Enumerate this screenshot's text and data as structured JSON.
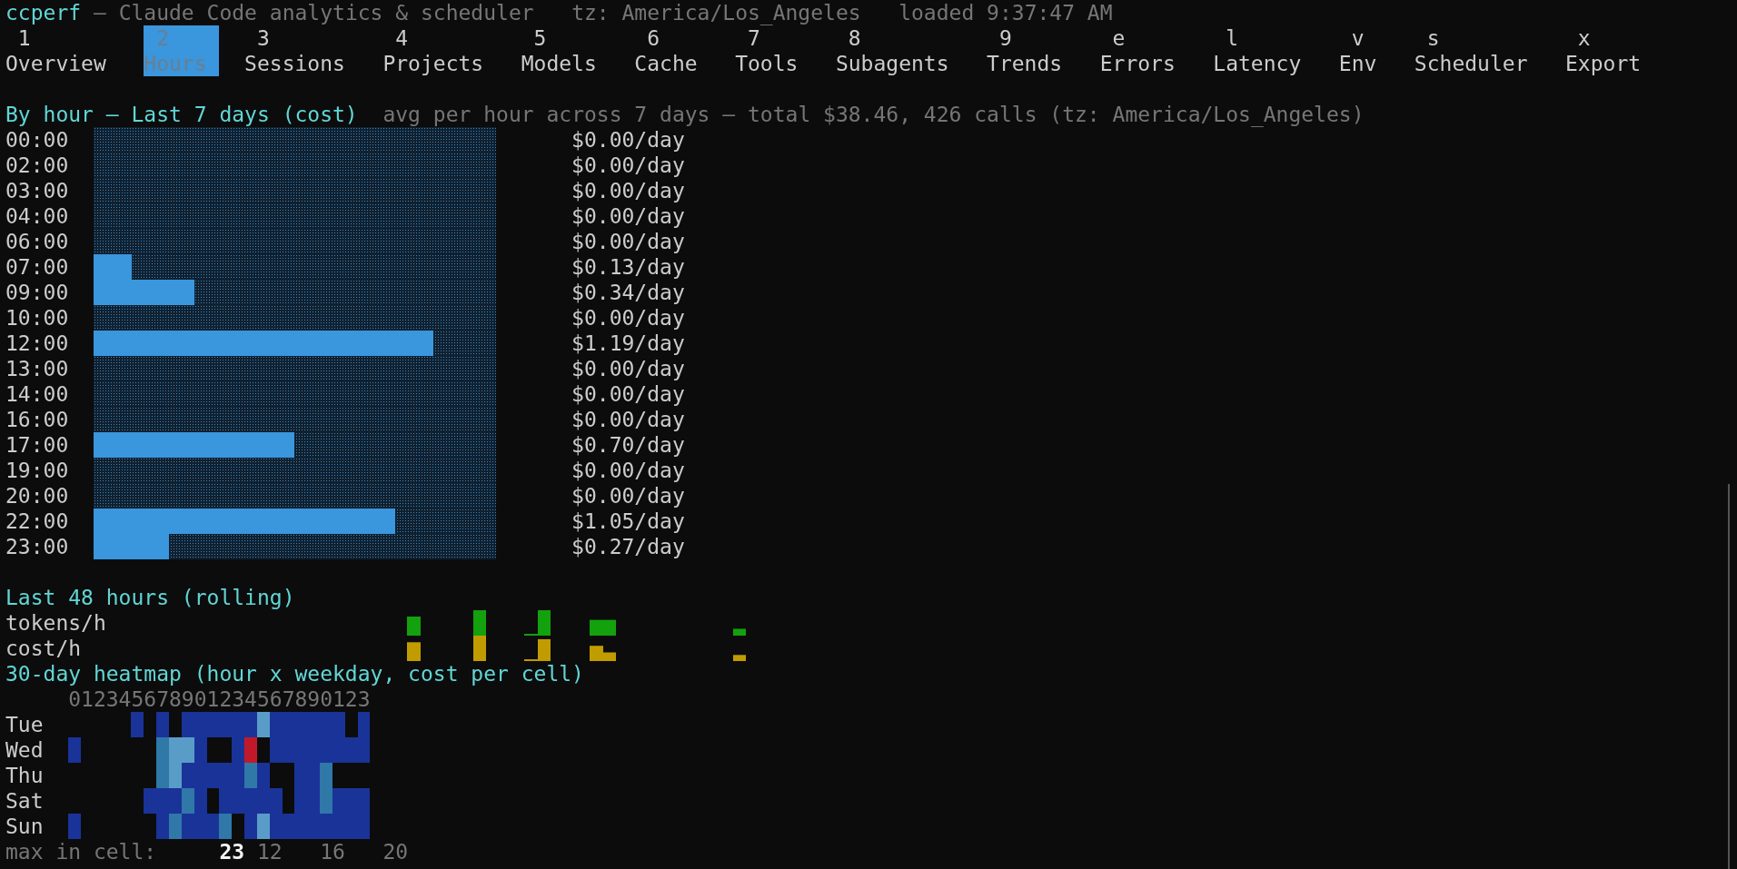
{
  "header": {
    "app": "ccperf",
    "subtitle": "— Claude Code analytics & scheduler",
    "timezone": "tz: America/Los_Angeles",
    "loaded": "loaded 9:37:47 AM"
  },
  "tabs": [
    {
      "key": "1",
      "label": "Overview",
      "selected": false
    },
    {
      "key": "2",
      "label": "Hours",
      "selected": true
    },
    {
      "key": "3",
      "label": "Sessions",
      "selected": false
    },
    {
      "key": "4",
      "label": "Projects",
      "selected": false
    },
    {
      "key": "5",
      "label": "Models",
      "selected": false
    },
    {
      "key": "6",
      "label": "Cache",
      "selected": false
    },
    {
      "key": "7",
      "label": "Tools",
      "selected": false
    },
    {
      "key": "8",
      "label": "Subagents",
      "selected": false
    },
    {
      "key": "9",
      "label": "Trends",
      "selected": false
    },
    {
      "key": "e",
      "label": "Errors",
      "selected": false
    },
    {
      "key": "l",
      "label": "Latency",
      "selected": false
    },
    {
      "key": "v",
      "label": "Env",
      "selected": false
    },
    {
      "key": "s",
      "label": "Scheduler",
      "selected": false
    },
    {
      "key": "x",
      "label": "Export",
      "selected": false
    }
  ],
  "by_hour": {
    "title": "By hour — Last 7 days (cost)",
    "summary": "avg per hour across 7 days — total $38.46, 426 calls (tz: America/Los_Angeles)",
    "rows": [
      {
        "hour": "00:00",
        "value": "$0.00/day"
      },
      {
        "hour": "02:00",
        "value": "$0.00/day"
      },
      {
        "hour": "03:00",
        "value": "$0.00/day"
      },
      {
        "hour": "04:00",
        "value": "$0.00/day"
      },
      {
        "hour": "06:00",
        "value": "$0.00/day"
      },
      {
        "hour": "07:00",
        "level": 0.094,
        "value": "$0.13/day"
      },
      {
        "hour": "09:00",
        "level": 0.25,
        "value": "$0.34/day"
      },
      {
        "hour": "10:00",
        "value": "$0.00/day"
      },
      {
        "hour": "12:00",
        "level": 0.844,
        "value": "$1.19/day"
      },
      {
        "hour": "13:00",
        "value": "$0.00/day"
      },
      {
        "hour": "14:00",
        "value": "$0.00/day"
      },
      {
        "hour": "16:00",
        "value": "$0.00/day"
      },
      {
        "hour": "17:00",
        "level": 0.5,
        "value": "$0.70/day"
      },
      {
        "hour": "19:00",
        "value": "$0.00/day"
      },
      {
        "hour": "20:00",
        "value": "$0.00/day"
      },
      {
        "hour": "22:00",
        "level": 0.75,
        "value": "$1.05/day"
      },
      {
        "hour": "23:00",
        "level": 0.188,
        "value": "$0.27/day"
      }
    ]
  },
  "rolling": {
    "title": "Last 48 hours (rolling)",
    "series": [
      {
        "label": "tokens/h",
        "kind": "tokens"
      },
      {
        "label": "cost/h",
        "kind": "cost"
      }
    ]
  },
  "heatmap": {
    "title": "30-day heatmap (hour x weekday, cost per cell)",
    "hours_axis": "012345678901234567890123",
    "rows": [
      {
        "day": "Tue",
        "cells": [
          null,
          null,
          null,
          null,
          null,
          {
            "color": "#1a3399"
          },
          null,
          {
            "color": "#1a3399"
          },
          null,
          {
            "color": "#1a3399"
          },
          {
            "color": "#1a3399"
          },
          {
            "color": "#1a3399"
          },
          {
            "color": "#1a3399"
          },
          {
            "color": "#1a3399"
          },
          {
            "color": "#1a3399"
          },
          {
            "color": "#5a9cc8"
          },
          {
            "color": "#1a3399"
          },
          {
            "color": "#1a3399"
          },
          {
            "color": "#1a3399"
          },
          {
            "color": "#1a3399"
          },
          {
            "color": "#1a3399"
          },
          {
            "color": "#1a3399"
          },
          null,
          {
            "color": "#1a3399"
          }
        ]
      },
      {
        "day": "Wed",
        "cells": [
          {
            "color": "#1a3399"
          },
          null,
          null,
          null,
          null,
          null,
          null,
          {
            "color": "#2f78a8"
          },
          {
            "color": "#5a9cc8"
          },
          {
            "color": "#5a9cc8"
          },
          {
            "color": "#1a3399"
          },
          null,
          null,
          {
            "color": "#1a3399"
          },
          {
            "color": "#c01a2a"
          },
          null,
          {
            "color": "#1a3399"
          },
          {
            "color": "#1a3399"
          },
          {
            "color": "#1a3399"
          },
          {
            "color": "#1a3399"
          },
          {
            "color": "#1a3399"
          },
          {
            "color": "#1a3399"
          },
          {
            "color": "#1a3399"
          },
          {
            "color": "#1a3399"
          }
        ]
      },
      {
        "day": "Thu",
        "cells": [
          null,
          null,
          null,
          null,
          null,
          null,
          null,
          {
            "color": "#2f78a8"
          },
          {
            "color": "#5a9cc8"
          },
          {
            "color": "#1a3399"
          },
          {
            "color": "#1a3399"
          },
          {
            "color": "#1a3399"
          },
          {
            "color": "#1a3399"
          },
          {
            "color": "#1a3399"
          },
          {
            "color": "#2f78a8"
          },
          {
            "color": "#1a3399"
          },
          null,
          null,
          {
            "color": "#1a3399"
          },
          {
            "color": "#1a3399"
          },
          {
            "color": "#2f78a8"
          },
          null,
          null,
          null
        ]
      },
      {
        "day": "Sat",
        "cells": [
          null,
          null,
          null,
          null,
          null,
          null,
          {
            "color": "#1a3399"
          },
          {
            "color": "#1a3399"
          },
          {
            "color": "#1a3399"
          },
          {
            "color": "#2f78a8"
          },
          {
            "color": "#1a3399"
          },
          null,
          {
            "color": "#1a3399"
          },
          {
            "color": "#1a3399"
          },
          {
            "color": "#1a3399"
          },
          {
            "color": "#1a3399"
          },
          {
            "color": "#1a3399"
          },
          null,
          {
            "color": "#1a3399"
          },
          {
            "color": "#1a3399"
          },
          {
            "color": "#2f78a8"
          },
          {
            "color": "#1a3399"
          },
          {
            "color": "#1a3399"
          },
          {
            "color": "#1a3399"
          }
        ]
      },
      {
        "day": "Sun",
        "cells": [
          {
            "color": "#1a3399"
          },
          null,
          null,
          null,
          null,
          null,
          null,
          {
            "color": "#1a3399"
          },
          {
            "color": "#2f78a8"
          },
          {
            "color": "#1a3399"
          },
          {
            "color": "#1a3399"
          },
          {
            "color": "#1a3399"
          },
          {
            "color": "#2f78a8"
          },
          null,
          {
            "color": "#1a3399"
          },
          {
            "color": "#5a9cc8"
          },
          {
            "color": "#1a3399"
          },
          {
            "color": "#1a3399"
          },
          {
            "color": "#1a3399"
          },
          {
            "color": "#1a3399"
          },
          {
            "color": "#1a3399"
          },
          {
            "color": "#1a3399"
          },
          {
            "color": "#1a3399"
          },
          {
            "color": "#1a3399"
          }
        ]
      }
    ],
    "max_label": "max in cell:",
    "max_values": [
      {
        "value": "23",
        "highlighted": true
      },
      {
        "value": "12",
        "highlighted": false
      },
      {
        "value": "16",
        "highlighted": false
      },
      {
        "value": "20",
        "highlighted": false
      }
    ]
  }
}
